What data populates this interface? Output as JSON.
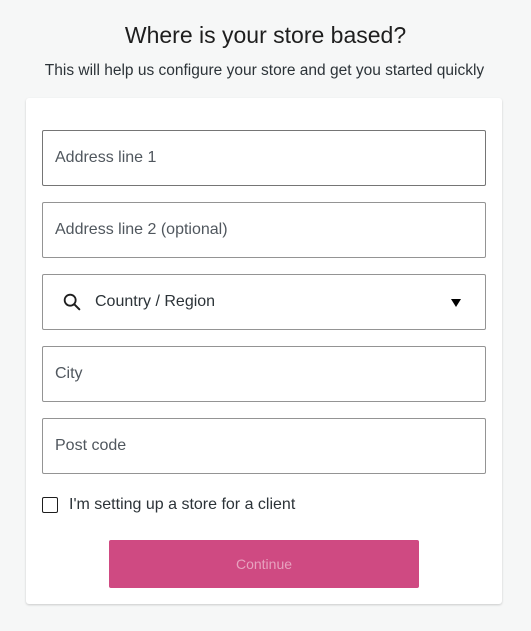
{
  "header": {
    "title": "Where is your store based?",
    "subtitle": "This will help us configure your store and get you started quickly"
  },
  "form": {
    "address1": {
      "placeholder": "Address line 1",
      "value": ""
    },
    "address2": {
      "placeholder": "Address line 2 (optional)",
      "value": ""
    },
    "country": {
      "label": "Country / Region",
      "icon": "search-icon",
      "dropdown_icon": "triangle-down-icon"
    },
    "city": {
      "placeholder": "City",
      "value": ""
    },
    "postcode": {
      "placeholder": "Post code",
      "value": ""
    },
    "client_checkbox": {
      "label": "I'm setting up a store for a client",
      "checked": false
    },
    "continue_label": "Continue"
  },
  "colors": {
    "accent": "#cf4a82",
    "accent_text_disabled": "#e7a2bf",
    "background": "#f6f7f7",
    "card": "#ffffff"
  }
}
